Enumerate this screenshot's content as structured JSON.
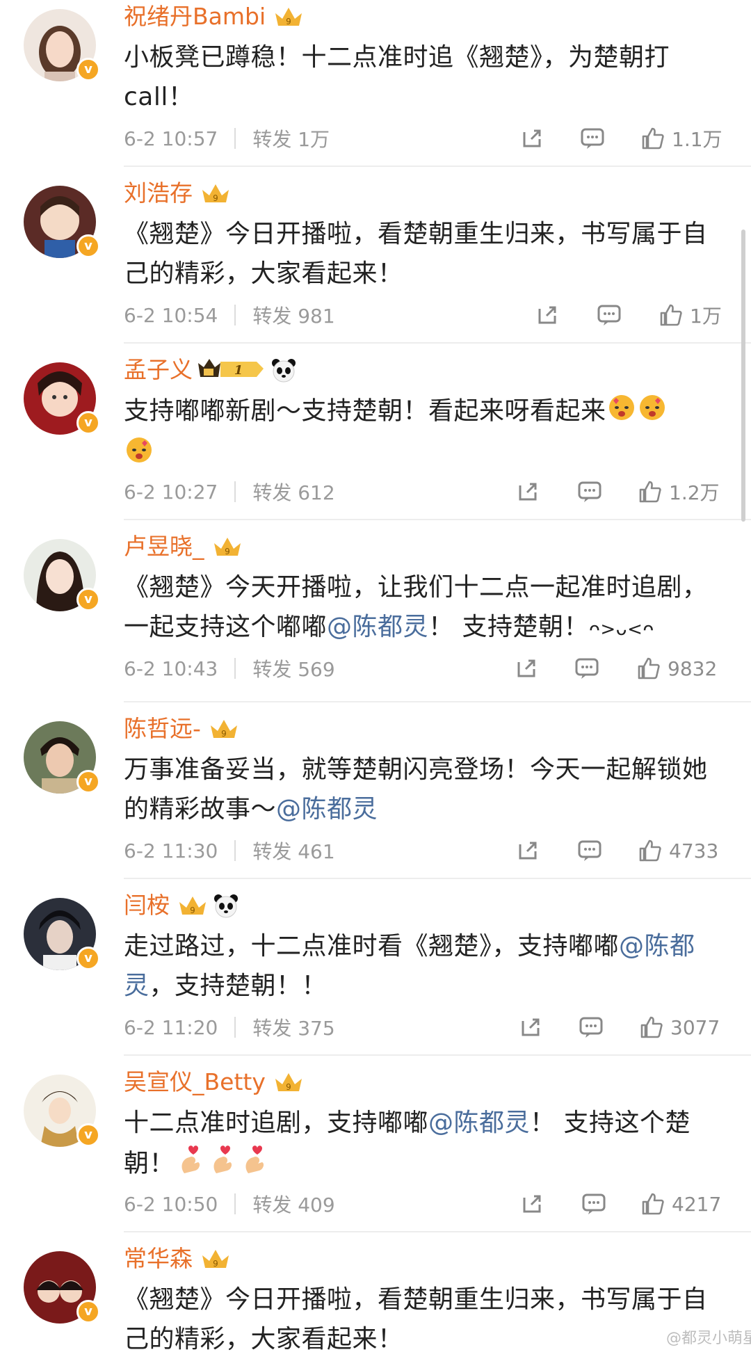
{
  "posts": [
    {
      "name": "祝绪丹Bambi",
      "content": [
        "小板凳已蹲稳！十二点准时追《翘楚》，为楚朝打",
        "call！"
      ],
      "time": "6-2 10:57",
      "repost": "转发 1万",
      "likes": "1.1万"
    },
    {
      "name": "刘浩存",
      "content": [
        "《翘楚》今日开播啦，看楚朝重生归来，书写属于自",
        "己的精彩，大家看起来！"
      ],
      "time": "6-2 10:54",
      "repost": "转发 981",
      "likes": "1万"
    },
    {
      "name": "孟子义",
      "content_a": "支持嘟嘟新剧～支持楚朝！看起来呀看起来",
      "medal_level": "1",
      "time": "6-2 10:27",
      "repost": "转发 612",
      "likes": "1.2万"
    },
    {
      "name": "卢昱晓_",
      "content_a": "《翘楚》今天开播啦，让我们十二点一起准时追剧，",
      "content_b": "一起支持这个嘟嘟",
      "mention": "@陈都灵",
      "content_c": "！ 支持楚朝！",
      "kaomoji": "ᴖ>ᴗ<ᴖ",
      "time": "6-2 10:43",
      "repost": "转发 569",
      "likes": "9832"
    },
    {
      "name": "陈哲远-",
      "content_a": "万事准备妥当，就等楚朝闪亮登场！今天一起解锁她",
      "content_b": "的精彩故事～",
      "mention": "@陈都灵",
      "time": "6-2 11:30",
      "repost": "转发 461",
      "likes": "4733"
    },
    {
      "name": "闫桉",
      "content_a": "走过路过，十二点准时看《翘楚》，支持嘟嘟",
      "mention_a": "@陈都",
      "mention_b": "灵",
      "content_b": "，支持楚朝！！",
      "time": "6-2 11:20",
      "repost": "转发 375",
      "likes": "3077"
    },
    {
      "name": "吴宣仪_Betty",
      "content_a": "十二点准时追剧，支持嘟嘟",
      "mention": "@陈都灵",
      "content_b": "！ 支持这个楚",
      "content_c": "朝！",
      "time": "6-2 10:50",
      "repost": "转发 409",
      "likes": "4217"
    },
    {
      "name": "常华森",
      "content": [
        "《翘楚》今日开播啦，看楚朝重生归来，书写属于自",
        "己的精彩，大家看起来！"
      ]
    }
  ],
  "watermark": "@都灵小萌星"
}
